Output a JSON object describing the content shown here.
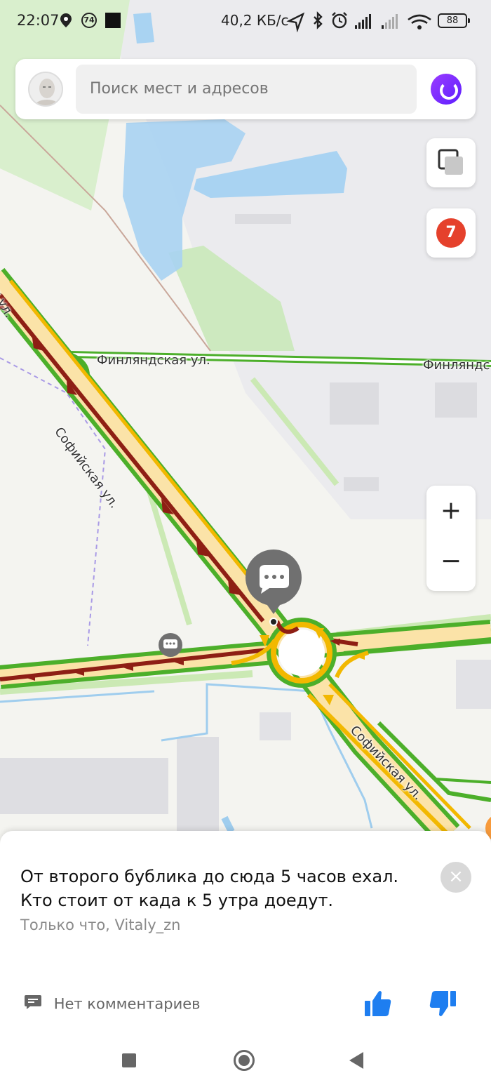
{
  "status_bar": {
    "time": "22:07",
    "badge": "74",
    "network_speed": "40,2 КБ/с",
    "battery": "88"
  },
  "search": {
    "placeholder": "Поиск мест и адресов"
  },
  "map": {
    "streets": {
      "finlyandskaya_1": "Финляндская ул.",
      "finlyandskaya_2": "Финляндс",
      "sofiyskaya_1": "Софийская ул.",
      "sofiyskaya_2": "Софийская ул.",
      "top_left_fragment": "ая ул."
    },
    "traffic_score": "7",
    "colors": {
      "jam": "#8e1f14",
      "slow": "#f2b800",
      "free": "#4caf2a",
      "water": "#a9d3f2",
      "park": "#cde9bf"
    }
  },
  "controls": {
    "zoom_in": "+",
    "zoom_out": "−"
  },
  "card": {
    "message": "От второго бублика до сюда 5 часов ехал. Кто стоит от када к 5 утра доедут.",
    "meta": "Только что, Vitaly_zn",
    "close": "×",
    "comments_label": "Нет комментариев"
  },
  "icons": {
    "location": "location-pin-icon",
    "layers": "layers-icon",
    "chat": "chat-bubble-icon",
    "comment": "comment-icon",
    "like": "thumbs-up-icon",
    "dislike": "thumbs-down-icon"
  }
}
